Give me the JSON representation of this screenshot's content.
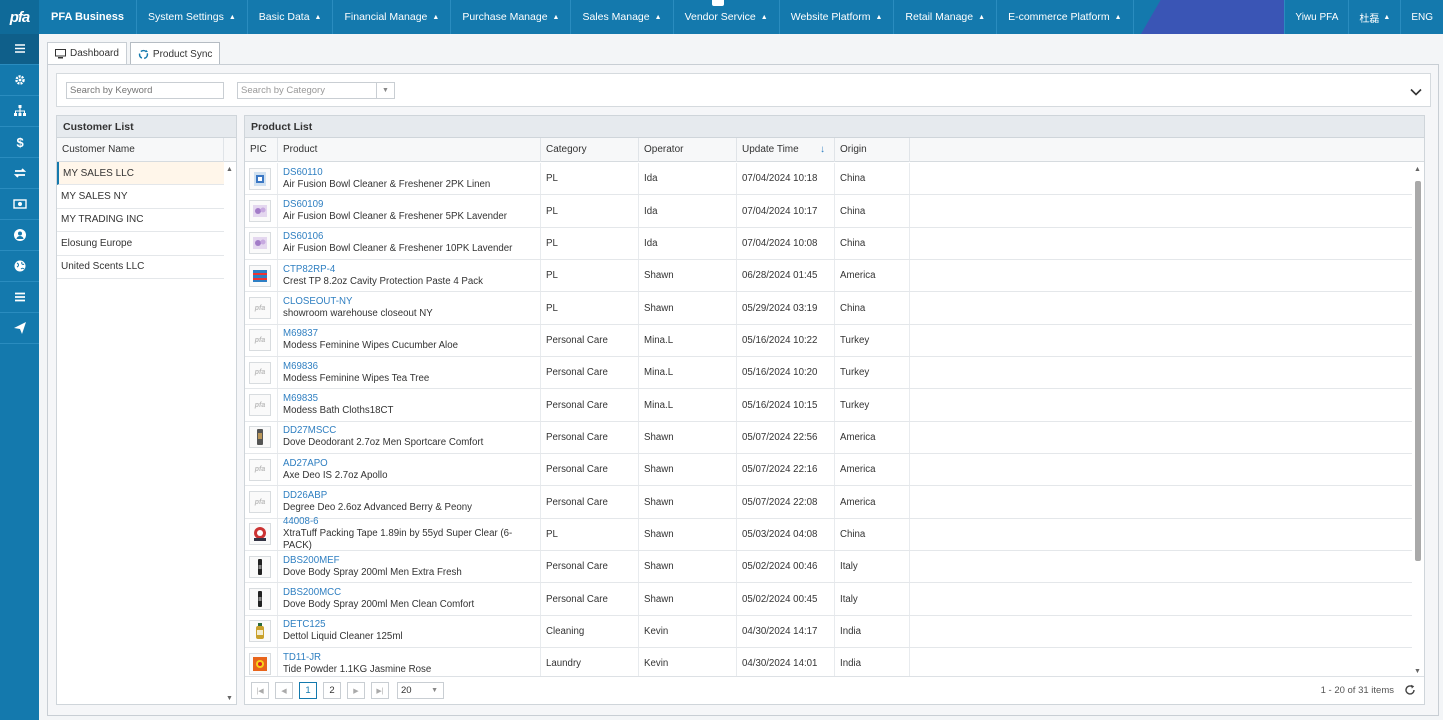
{
  "topbar": {
    "logo": "pfa",
    "brand": "PFA Business",
    "menu": [
      "System Settings",
      "Basic Data",
      "Financial Manage",
      "Purchase Manage",
      "Sales Manage",
      "Vendor Service",
      "Website Platform",
      "Retail Manage",
      "E-commerce Platform"
    ],
    "company": "Yiwu PFA",
    "user": "杜磊",
    "lang": "ENG"
  },
  "sidebar_icons": [
    "list-icon",
    "gear-icon",
    "org-chart-icon",
    "dollar-icon",
    "sync-icon",
    "cash-icon",
    "user-circle-icon",
    "globe-icon",
    "menu-icon",
    "send-icon"
  ],
  "tabs": [
    {
      "label": "Dashboard",
      "icon": "monitor-icon"
    },
    {
      "label": "Product Sync",
      "icon": "recycle-icon"
    }
  ],
  "search": {
    "keyword_placeholder": "Search by Keyword",
    "category_placeholder": "Search by Category"
  },
  "customers": {
    "title": "Customer List",
    "column": "Customer Name",
    "items": [
      "MY SALES LLC",
      "MY SALES NY",
      "MY TRADING INC",
      "Elosung Europe",
      "United Scents LLC"
    ],
    "selected": 0
  },
  "products": {
    "title": "Product List",
    "columns": {
      "pic": "PIC",
      "product": "Product",
      "category": "Category",
      "operator": "Operator",
      "update": "Update Time",
      "origin": "Origin"
    },
    "rows": [
      {
        "code": "DS60110",
        "name": "Air Fusion Bowl Cleaner & Freshener 2PK Linen",
        "category": "PL",
        "operator": "Ida",
        "time": "07/04/2024 10:18",
        "origin": "China",
        "pic": "blue"
      },
      {
        "code": "DS60109",
        "name": "Air Fusion Bowl Cleaner & Freshener 5PK Lavender",
        "category": "PL",
        "operator": "Ida",
        "time": "07/04/2024 10:17",
        "origin": "China",
        "pic": "lavender"
      },
      {
        "code": "DS60106",
        "name": "Air Fusion Bowl Cleaner & Freshener 10PK Lavender",
        "category": "PL",
        "operator": "Ida",
        "time": "07/04/2024 10:08",
        "origin": "China",
        "pic": "lavender"
      },
      {
        "code": "CTP82RP-4",
        "name": "Crest TP 8.2oz Cavity Protection Paste 4 Pack",
        "category": "PL",
        "operator": "Shawn",
        "time": "06/28/2024 01:45",
        "origin": "America",
        "pic": "crest"
      },
      {
        "code": "CLOSEOUT-NY",
        "name": "showroom warehouse closeout NY",
        "category": "PL",
        "operator": "Shawn",
        "time": "05/29/2024 03:19",
        "origin": "China",
        "pic": "pfa"
      },
      {
        "code": "M69837",
        "name": "Modess Feminine Wipes Cucumber Aloe",
        "category": "Personal Care",
        "operator": "Mina.L",
        "time": "05/16/2024 10:22",
        "origin": "Turkey",
        "pic": "pfa"
      },
      {
        "code": "M69836",
        "name": "Modess Feminine Wipes Tea Tree",
        "category": "Personal Care",
        "operator": "Mina.L",
        "time": "05/16/2024 10:20",
        "origin": "Turkey",
        "pic": "pfa"
      },
      {
        "code": "M69835",
        "name": "Modess Bath Cloths18CT",
        "category": "Personal Care",
        "operator": "Mina.L",
        "time": "05/16/2024 10:15",
        "origin": "Turkey",
        "pic": "pfa"
      },
      {
        "code": "DD27MSCC",
        "name": "Dove Deodorant 2.7oz Men Sportcare Comfort",
        "category": "Personal Care",
        "operator": "Shawn",
        "time": "05/07/2024 22:56",
        "origin": "America",
        "pic": "deo"
      },
      {
        "code": "AD27APO",
        "name": "Axe Deo IS 2.7oz Apollo",
        "category": "Personal Care",
        "operator": "Shawn",
        "time": "05/07/2024 22:16",
        "origin": "America",
        "pic": "pfa"
      },
      {
        "code": "DD26ABP",
        "name": "Degree Deo 2.6oz Advanced Berry & Peony",
        "category": "Personal Care",
        "operator": "Shawn",
        "time": "05/07/2024 22:08",
        "origin": "America",
        "pic": "pfa"
      },
      {
        "code": "44008-6",
        "name": "XtraTuff Packing Tape 1.89in by 55yd Super Clear (6-PACK)",
        "category": "PL",
        "operator": "Shawn",
        "time": "05/03/2024 04:08",
        "origin": "China",
        "pic": "tape"
      },
      {
        "code": "DBS200MEF",
        "name": "Dove Body Spray 200ml Men Extra Fresh",
        "category": "Personal Care",
        "operator": "Shawn",
        "time": "05/02/2024 00:46",
        "origin": "Italy",
        "pic": "spray"
      },
      {
        "code": "DBS200MCC",
        "name": "Dove Body Spray 200ml Men Clean Comfort",
        "category": "Personal Care",
        "operator": "Shawn",
        "time": "05/02/2024 00:45",
        "origin": "Italy",
        "pic": "spray"
      },
      {
        "code": "DETC125",
        "name": "Dettol Liquid Cleaner 125ml",
        "category": "Cleaning",
        "operator": "Kevin",
        "time": "04/30/2024 14:17",
        "origin": "India",
        "pic": "dettol"
      },
      {
        "code": "TD11-JR",
        "name": "Tide Powder 1.1KG Jasmine Rose",
        "category": "Laundry",
        "operator": "Kevin",
        "time": "04/30/2024 14:01",
        "origin": "India",
        "pic": "tide"
      }
    ]
  },
  "pager": {
    "pages": [
      "1",
      "2"
    ],
    "current": "1",
    "page_size": "20",
    "info": "1 - 20 of 31 items"
  },
  "colors": {
    "primary": "#1479ad",
    "accent": "#3a55b5",
    "link": "#2f7fc1"
  }
}
